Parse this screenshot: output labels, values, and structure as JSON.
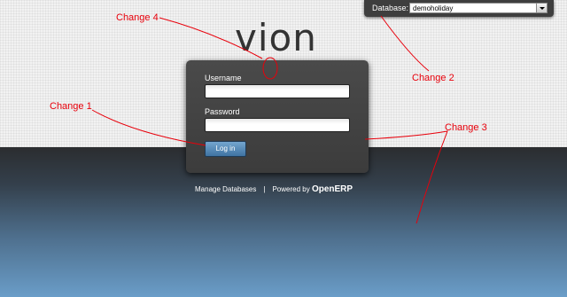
{
  "database": {
    "label": "Database:",
    "selected": "demoholiday"
  },
  "logo": {
    "text": "vion"
  },
  "login": {
    "username_label": "Username",
    "password_label": "Password",
    "username_value": "",
    "password_value": "",
    "button_label": "Log in"
  },
  "footer": {
    "manage_link": "Manage Databases",
    "separator": "|",
    "powered_by": "Powered by",
    "brand": "OpenERP"
  },
  "annotations": {
    "change1": "Change 1",
    "change2": "Change 2",
    "change3": "Change 3",
    "change4": "Change 4",
    "color": "#e8000b"
  }
}
